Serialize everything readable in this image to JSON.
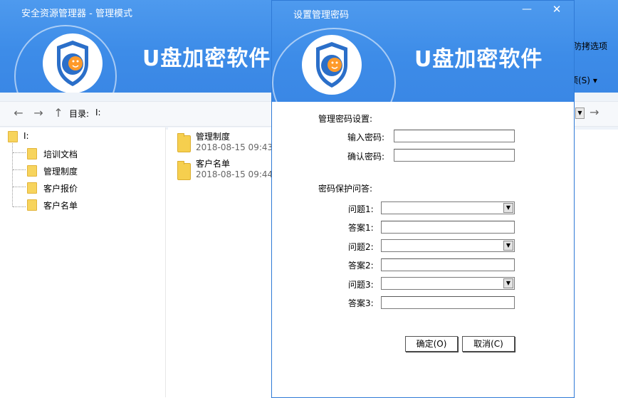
{
  "main_window": {
    "title": "安全资源管理器 - 管理模式",
    "app_name": "U盘加密软件",
    "menu_partial_1": "防拷选项",
    "menu_partial_2": "项(S)"
  },
  "nav": {
    "back_icon": "arrow-left-icon",
    "forward_icon": "arrow-right-icon",
    "up_icon": "arrow-up-icon",
    "dir_label": "目录:",
    "dir_value": "I:",
    "go_icon": "arrow-right-icon"
  },
  "tree": {
    "root": "I:",
    "items": [
      "培训文档",
      "管理制度",
      "客户报价",
      "客户名单"
    ]
  },
  "files": [
    {
      "name": "管理制度",
      "date": "2018-08-15 09:43:"
    },
    {
      "name": "客户名单",
      "date": "2018-08-15 09:44:"
    }
  ],
  "dialog": {
    "title": "设置管理密码",
    "app_name": "U盘加密软件",
    "password_section": "管理密码设置:",
    "enter_password_label": "输入密码:",
    "confirm_password_label": "确认密码:",
    "question_section": "密码保护问答:",
    "question1_label": "问题1:",
    "answer1_label": "答案1:",
    "question2_label": "问题2:",
    "answer2_label": "答案2:",
    "question3_label": "问题3:",
    "answer3_label": "答案3:",
    "ok_button": "确定(O)",
    "cancel_button": "取消(C)"
  },
  "colors": {
    "header_blue": "#3d8ce8",
    "folder_yellow": "#f6cf4e",
    "shield_blue": "#2b6fc9"
  }
}
